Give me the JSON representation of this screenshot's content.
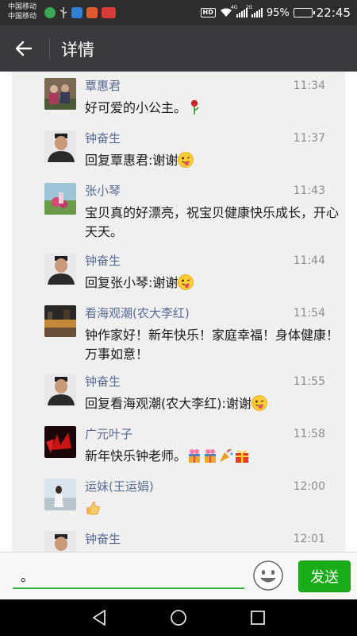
{
  "status_bar": {
    "carrier_1": "中国移动",
    "carrier_2": "中国移动",
    "hd": "HD",
    "net_1": "4G",
    "net_2": "2G",
    "battery_percent": "95%",
    "battery_level": 0.95,
    "time": "22:45",
    "app_icon_colors": [
      "#3aa757",
      "#e05a2b",
      "#e34f3e",
      "#d93a3a"
    ]
  },
  "header": {
    "back_icon": "back-arrow-icon",
    "title": "详情"
  },
  "comments": [
    {
      "name": "覃惠君",
      "time": "11:34",
      "text": "好可爱的小公主。",
      "emojis": [
        "rose-emoji"
      ],
      "avatar": "avatar-group"
    },
    {
      "name": "钟奋生",
      "time": "11:37",
      "text": "回复覃惠君:谢谢",
      "emojis": [
        "wink-tongue-emoji"
      ],
      "avatar": "avatar-man"
    },
    {
      "name": "张小琴",
      "time": "11:43",
      "text": "宝贝真的好漂亮，祝宝贝健康快乐成长，开心天天。",
      "emojis": [],
      "avatar": "avatar-scenery"
    },
    {
      "name": "钟奋生",
      "time": "11:44",
      "text": "回复张小琴:谢谢",
      "emojis": [
        "wink-tongue-emoji"
      ],
      "avatar": "avatar-man"
    },
    {
      "name": "看海观潮(农大李红)",
      "time": "11:54",
      "text": "钟作家好！新年快乐！家庭幸福！身体健康！万事如意！",
      "emojis": [],
      "avatar": "avatar-night"
    },
    {
      "name": "钟奋生",
      "time": "11:55",
      "text": "回复看海观潮(农大李红):谢谢",
      "emojis": [
        "wink-tongue-emoji"
      ],
      "avatar": "avatar-man"
    },
    {
      "name": "广元叶子",
      "time": "11:58",
      "text": "新年快乐钟老师。",
      "emojis": [
        "gift-emoji",
        "gift-emoji",
        "party-popper-emoji",
        "present-emoji"
      ],
      "avatar": "avatar-red-leaves"
    },
    {
      "name": "运妹(王运娟)",
      "time": "12:00",
      "text": "",
      "emojis": [
        "thumbs-up-emoji"
      ],
      "avatar": "avatar-woman"
    },
    {
      "name": "钟奋生",
      "time": "12:01",
      "text": "",
      "emojis": [],
      "avatar": "avatar-man"
    }
  ],
  "input": {
    "value": "。",
    "emoji_icon": "smiley-face-icon",
    "send_label": "发送"
  },
  "nav": {
    "back_icon": "nav-back-icon",
    "home_icon": "nav-home-icon",
    "recents_icon": "nav-recents-icon"
  },
  "colors": {
    "accent_green": "#1aad19",
    "name_blue": "#576b95",
    "title_bar": "#383a3d"
  }
}
